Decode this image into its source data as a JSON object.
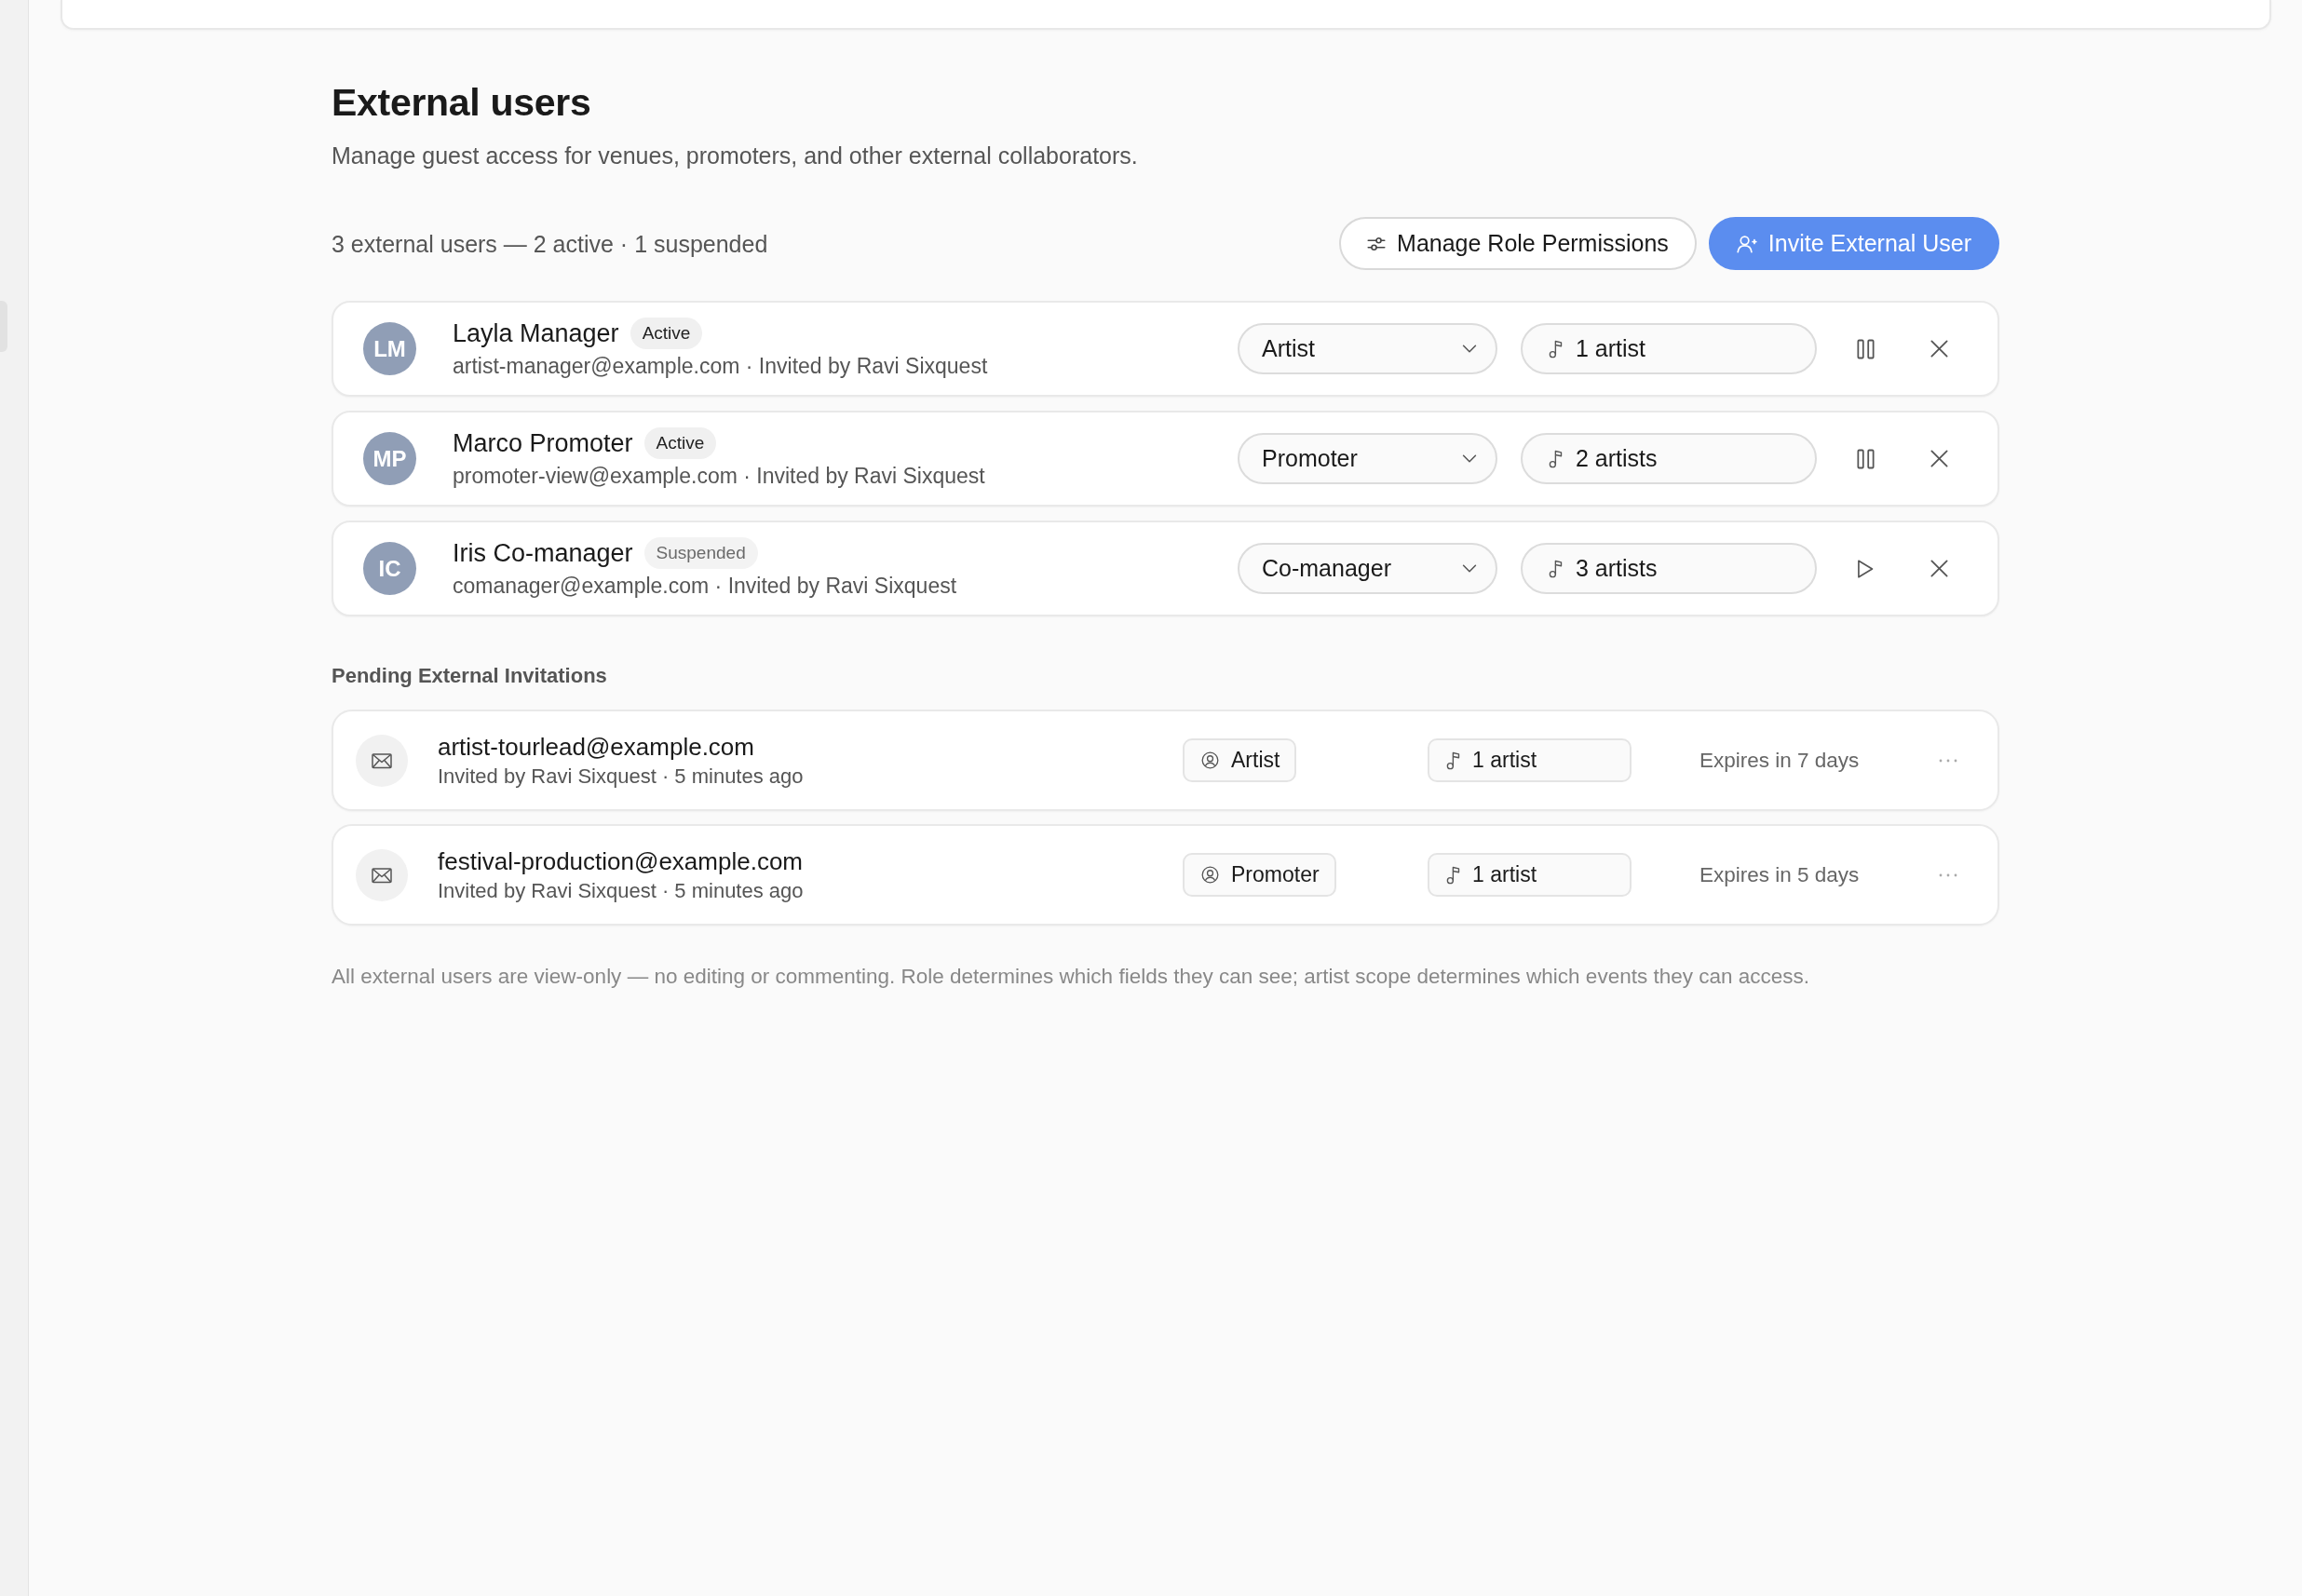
{
  "header": {
    "title": "External users",
    "subtitle": "Manage guest access for venues, promoters, and other external collaborators."
  },
  "summary": "3 external users — 2 active · 1 suspended",
  "actions": [
    {
      "kind": "secondary",
      "label": "Manage Role Permissions"
    },
    {
      "kind": "primary",
      "label": "Invite External User"
    }
  ],
  "users": [
    {
      "initials": "LM",
      "name": "Layla Manager",
      "status": "Active",
      "suspended": false,
      "detail": "artist-manager@example.com · Invited by Ravi Sixquest",
      "role": "Artist",
      "artists": "1 artist"
    },
    {
      "initials": "MP",
      "name": "Marco Promoter",
      "status": "Active",
      "suspended": false,
      "detail": "promoter-view@example.com · Invited by Ravi Sixquest",
      "role": "Promoter",
      "artists": "2 artists"
    },
    {
      "initials": "IC",
      "name": "Iris Co-manager",
      "status": "Suspended",
      "suspended": true,
      "detail": "comanager@example.com · Invited by Ravi Sixquest",
      "role": "Co-manager",
      "artists": "3 artists"
    }
  ],
  "pending": {
    "title": "Pending External Invitations",
    "invitations": [
      {
        "email": "artist-tourlead@example.com",
        "detail": "Invited by Ravi Sixquest · 5 minutes ago",
        "role": "Artist",
        "artists": "1 artist",
        "expires": "Expires in 7 days"
      },
      {
        "email": "festival-production@example.com",
        "detail": "Invited by Ravi Sixquest · 5 minutes ago",
        "role": "Promoter",
        "artists": "1 artist",
        "expires": "Expires in 5 days"
      }
    ]
  },
  "footnote": "All external users are view-only — no editing or commenting. Role determines which fields they can see; artist scope determines which events they can access."
}
